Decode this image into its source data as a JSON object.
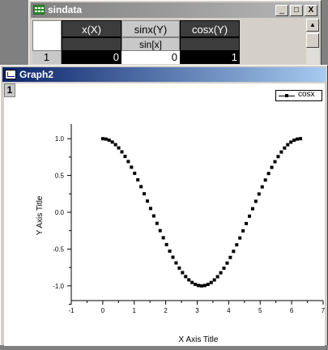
{
  "worksheet": {
    "title": "sindata",
    "columns": [
      {
        "name": "x(X)",
        "long_name": ""
      },
      {
        "name": "sinx(Y)",
        "long_name": "sin[x]"
      },
      {
        "name": "cosx(Y)",
        "long_name": ""
      }
    ],
    "row_label": "1",
    "row_values": [
      "0",
      "0",
      "1"
    ],
    "buttons": {
      "minimize": "_",
      "maximize": "□",
      "close": "X"
    },
    "scroll_up": "▲"
  },
  "graph": {
    "title": "Graph2",
    "layer": "1",
    "legend_label": "cosx",
    "chart_data": {
      "type": "scatter",
      "xlabel": "X Axis Title",
      "ylabel": "Y Axis Title",
      "xlim": [
        -1,
        7
      ],
      "ylim": [
        -1.2,
        1.2
      ],
      "x_ticks": [
        "-1",
        "0",
        "1",
        "2",
        "3",
        "4",
        "5",
        "6",
        "7"
      ],
      "y_ticks": [
        "1.0",
        "0.5",
        "0.0",
        "-0.5",
        "-1.0"
      ],
      "series": [
        {
          "name": "cosx",
          "x_start": 0,
          "x_end": 6.28,
          "points": 63,
          "function": "cos(x)"
        }
      ]
    }
  }
}
